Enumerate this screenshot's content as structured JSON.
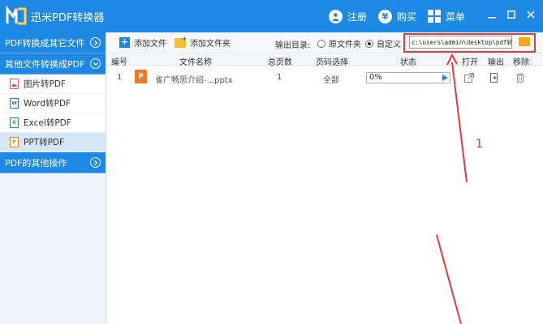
{
  "titlebar": {
    "app_title": "迅米PDF转换器",
    "register_label": "注册",
    "buy_label": "购买",
    "menu_label": "菜单"
  },
  "sidebar": {
    "group1_label": "PDF转换成其它文件",
    "group2_label": "其他文件转换成PDF",
    "items": [
      {
        "label": "图片转PDF",
        "icon": "image-file-icon"
      },
      {
        "label": "Word转PDF",
        "icon": "word-file-icon"
      },
      {
        "label": "Excel转PDF",
        "icon": "excel-file-icon"
      },
      {
        "label": "PPT转PDF",
        "icon": "ppt-file-icon"
      }
    ],
    "group3_label": "PDF的其他操作"
  },
  "toolbar": {
    "add_file_label": "添加文件",
    "add_folder_label": "添加文件夹",
    "output_label": "输出目录:",
    "radio_original_label": "原文件夹",
    "radio_custom_label": "自定义",
    "path_value": "c:\\users\\admin\\desktop\\pdf转换"
  },
  "table": {
    "headers": {
      "index": "编号",
      "filename": "文件名称",
      "pages": "总页数",
      "page_select": "页码选择",
      "status": "状态",
      "open": "打开",
      "output": "输出",
      "remove": "移除"
    },
    "rows": [
      {
        "index": "1",
        "filename": "雀广畅思介绍-...pptx",
        "pages": "1",
        "page_select": "全部",
        "progress": "0%"
      }
    ]
  },
  "annotation": {
    "label": "1",
    "color": "#e23b3b"
  },
  "colors": {
    "accent": "#1e88e5",
    "highlight": "#e23b3b"
  }
}
